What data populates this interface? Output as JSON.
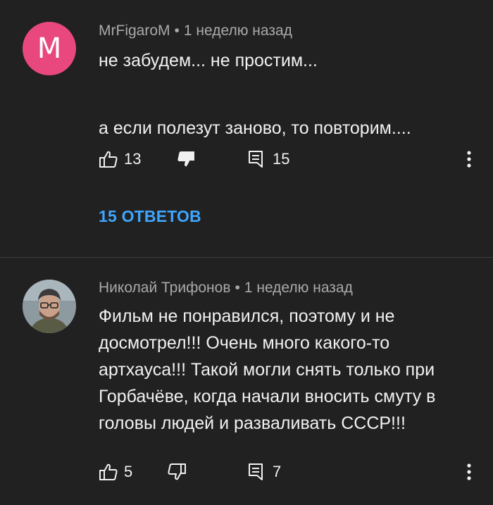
{
  "comments": [
    {
      "author": "MrFigaroM",
      "separator": "•",
      "time": "1 неделю назад",
      "avatar_letter": "M",
      "avatar_color": "#e8487d",
      "text_lines": [
        "не забудем... не простим...",
        "а если полезут заново, то повторим...."
      ],
      "likes": "13",
      "replies": "15",
      "replies_link": "15 ОТВЕТОВ"
    },
    {
      "author": "Николай Трифонов",
      "separator": "•",
      "time": "1 неделю назад",
      "avatar_color": "#7f8e93",
      "text_lines": [
        "Фильм не понравился, поэтому и не досмотрел!!! Очень много какого-то артхауса!!! Такой могли снять только при Горбачёве, когда начали вносить смуту в головы людей и разваливать СССР!!!"
      ],
      "likes": "5",
      "replies": "7"
    }
  ],
  "icons": {
    "like": "thumb-up-icon",
    "dislike_filled": "thumb-down-filled-icon",
    "dislike": "thumb-down-icon",
    "reply": "reply-icon",
    "more": "more-vertical-icon"
  },
  "colors": {
    "background": "#212121",
    "text": "#f1f1f1",
    "meta": "#a9a9a9",
    "link": "#3ea6ff"
  }
}
